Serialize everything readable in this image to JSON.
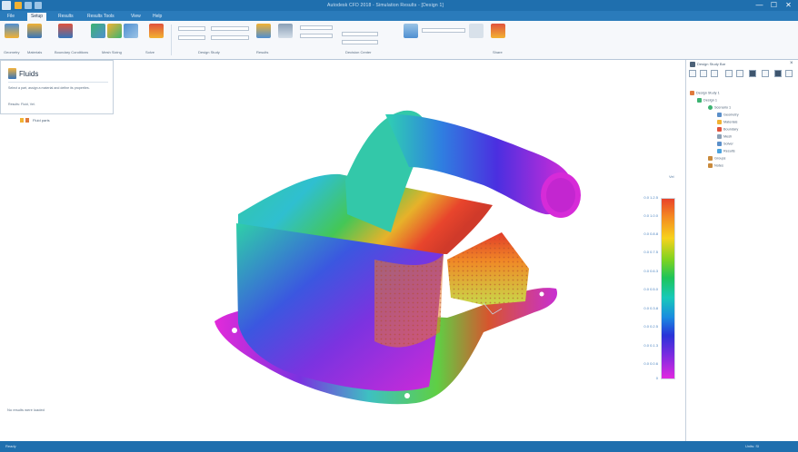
{
  "window": {
    "title": "Autodesk CFD 2018 - Simulation Results - [Design 1]",
    "controls": [
      "—",
      "☐",
      "✕"
    ]
  },
  "ribbon": {
    "tabs": [
      "File",
      "Setup",
      "Results",
      "Results Tools",
      "View",
      "Help"
    ],
    "active_tab": 1,
    "groups": [
      {
        "label": "Geometry"
      },
      {
        "label": "Materials"
      },
      {
        "label": "Boundary Conditions"
      },
      {
        "label": "Mesh Sizing"
      },
      {
        "label": "Solve"
      },
      {
        "label": "Design Study"
      },
      {
        "label": "Results"
      },
      {
        "label": "Decision Center"
      },
      {
        "label": "Share"
      }
    ]
  },
  "left_panel": {
    "title": "Fluids",
    "description": "Select a part, assign a material and define its properties.",
    "meta": "Results: Fluid, Vel.",
    "legend_item": "Fluid parts",
    "footer": "No results were loaded"
  },
  "scale": {
    "title": "Vel",
    "ticks": [
      "0.0 1.2.5",
      "0.0 1.0.0",
      "0.0 0.8.8",
      "0.0 0.7.5",
      "0.0 0.6.3",
      "0.0 0.5.0",
      "0.0 0.3.8",
      "0.0 0.2.5",
      "0.0 0.1.3",
      "0.0 0.0.6",
      "0"
    ]
  },
  "right_panel": {
    "title": "Design Study Bar",
    "tree": [
      {
        "label": "Design Study 1",
        "color": "#e07a3c",
        "indent": 0
      },
      {
        "label": "Design 1",
        "color": "#3cb371",
        "indent": 1
      },
      {
        "label": "Scenario 1",
        "color": "#3cb371",
        "indent": 2
      },
      {
        "label": "Geometry",
        "color": "#5b8fc9",
        "indent": 3
      },
      {
        "label": "Materials",
        "color": "#f2b233",
        "indent": 3
      },
      {
        "label": "Boundary",
        "color": "#e0523c",
        "indent": 3
      },
      {
        "label": "Mesh",
        "color": "#8aa0b6",
        "indent": 3
      },
      {
        "label": "Solver",
        "color": "#5b8fc9",
        "indent": 3
      },
      {
        "label": "Results",
        "color": "#4aa3df",
        "indent": 3
      },
      {
        "label": "Groups",
        "color": "#c98a3c",
        "indent": 2
      },
      {
        "label": "Notes",
        "color": "#c98a3c",
        "indent": 2
      }
    ]
  },
  "statusbar": {
    "left": "Ready",
    "right": "Units: SI"
  },
  "colors": {
    "accent": "#1f6fae",
    "ribbon_bg": "#f6f8fb",
    "panel_border": "#c4d0dc"
  }
}
